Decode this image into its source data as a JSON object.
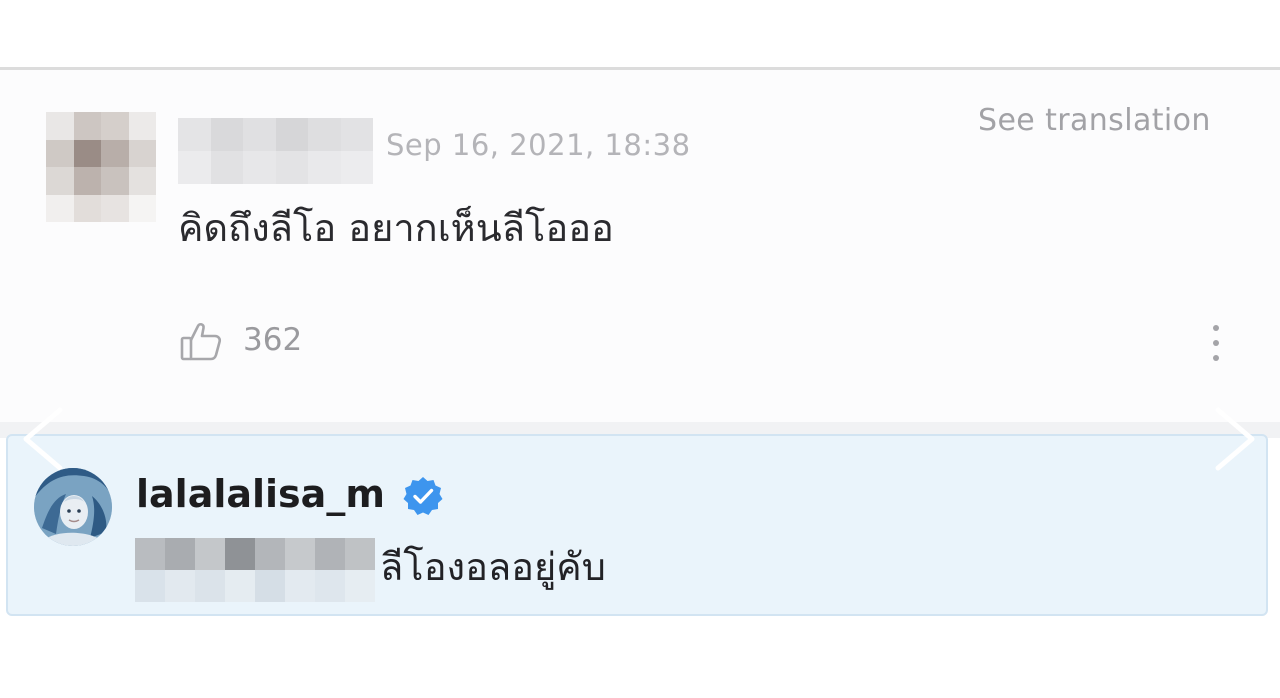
{
  "comment": {
    "timestamp": "Sep 16, 2021, 18:38",
    "see_translation_label": "See translation",
    "text": "คิดถึงลีโอ อยากเห็นลีโอออ",
    "like_count": "362",
    "like_icon": "thumbs-up-icon",
    "more_icon": "more-vertical-icon"
  },
  "reply": {
    "username": "lalalalisa_m",
    "verified_icon": "verified-badge-icon",
    "text": "ลีโองอลอยู่คับ"
  },
  "colors": {
    "timestamp": "#b4b4b8",
    "reply_background": "#eaf4fb",
    "verified_blue": "#3d95ee"
  }
}
